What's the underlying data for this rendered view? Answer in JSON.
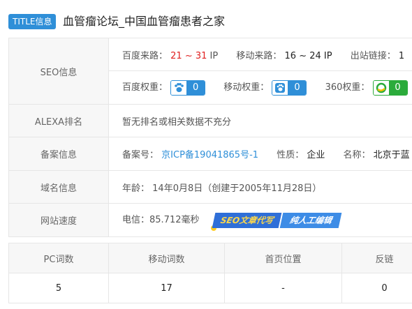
{
  "header": {
    "badge": "TITLE信息",
    "site_title": "血管瘤论坛_中国血管瘤患者之家"
  },
  "seo": {
    "label": "SEO信息",
    "baidu_traffic_label": "百度来路：",
    "baidu_traffic_value": "21 ~ 31",
    "baidu_traffic_unit": "IP",
    "mobile_traffic_label": "移动来路：",
    "mobile_traffic_value": "16 ~ 24 IP",
    "outlinks_label": "出站链接：",
    "outlinks_value": "1",
    "baidu_weight_label": "百度权重：",
    "baidu_weight_value": "0",
    "mobile_weight_label": "移动权重：",
    "mobile_weight_value": "0",
    "w360_label": "360权重：",
    "w360_value": "0",
    "colors": {
      "blue": "#2f8fd8",
      "green": "#2bab3b",
      "red": "#e02020"
    }
  },
  "alexa": {
    "label": "ALEXA排名",
    "value": "暂无排名或相关数据不充分"
  },
  "icp": {
    "label": "备案信息",
    "number_label": "备案号：",
    "number_value": "京ICP备19041865号-1",
    "nature_label": "性质：",
    "nature_value": "企业",
    "name_label": "名称：",
    "name_value": "北京于蓝"
  },
  "domain": {
    "label": "域名信息",
    "age_label": "年龄：",
    "age_value": "14年0月8日（创建于2005年11月28日）"
  },
  "speed": {
    "label": "网站速度",
    "value": "电信：85.712毫秒",
    "banner_left": "SEO文章代写",
    "banner_right": "纯人工编辑"
  },
  "keywords": {
    "headers": [
      "PC词数",
      "移动词数",
      "首页位置",
      "反链"
    ],
    "values": [
      "5",
      "17",
      "-",
      "0"
    ]
  }
}
